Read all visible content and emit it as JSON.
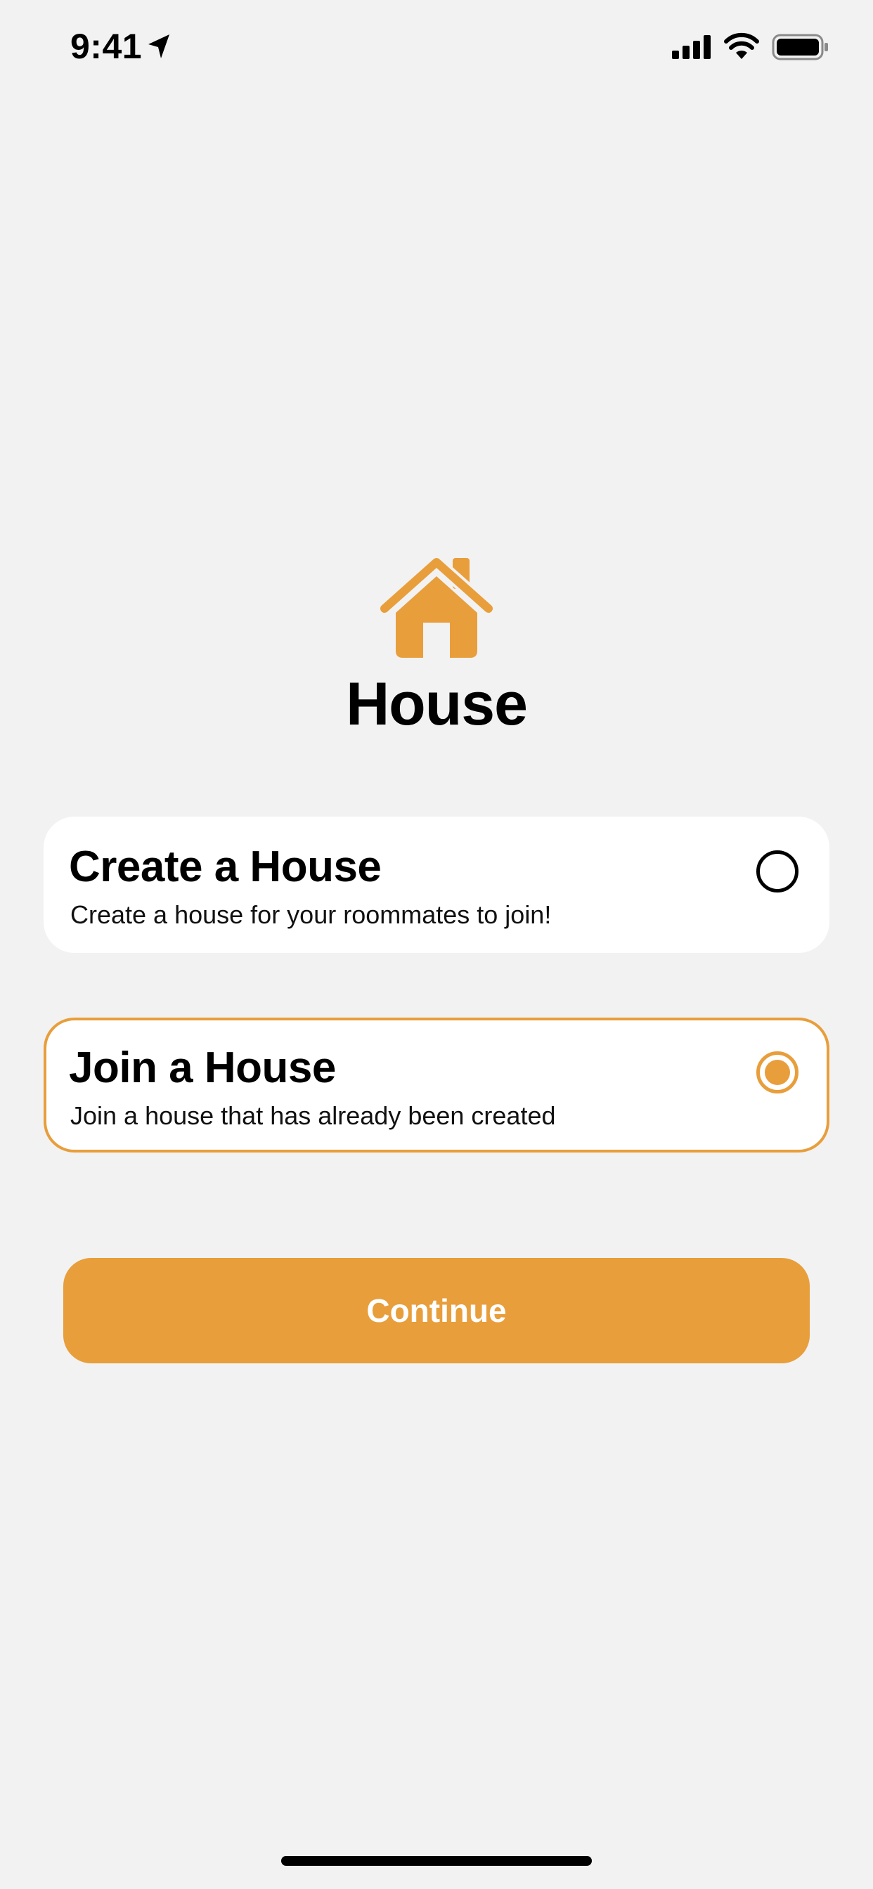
{
  "status_bar": {
    "time": "9:41",
    "icons": [
      "location-arrow-icon",
      "cellular-signal-icon",
      "wifi-icon",
      "battery-icon"
    ]
  },
  "header": {
    "icon": "house-icon",
    "title": "House"
  },
  "options": [
    {
      "title": "Create a House",
      "description": "Create a house for your roommates to join!",
      "selected": false
    },
    {
      "title": "Join a House",
      "description": "Join a house that has already been created",
      "selected": true
    }
  ],
  "actions": {
    "continue_label": "Continue"
  },
  "colors": {
    "accent": "#e89e3b",
    "background": "#f2f2f2",
    "card": "#ffffff",
    "text": "#000000"
  }
}
